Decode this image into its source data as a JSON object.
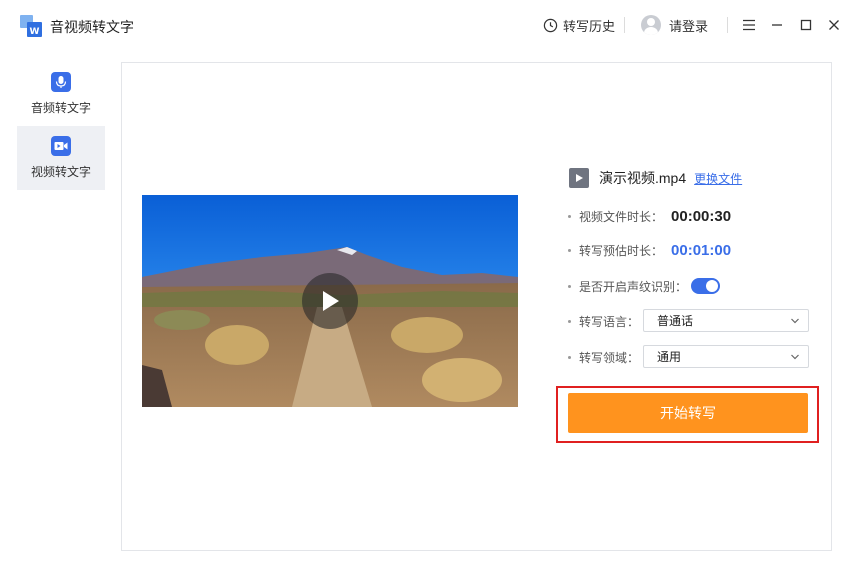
{
  "app": {
    "title": "音视频转文字"
  },
  "header": {
    "history_label": "转写历史",
    "login_label": "请登录"
  },
  "sidebar": {
    "items": [
      {
        "label": "音频转文字",
        "icon": "microphone-icon",
        "active": false
      },
      {
        "label": "视频转文字",
        "icon": "video-camera-icon",
        "active": true
      }
    ]
  },
  "file": {
    "name": "演示视频.mp4",
    "change_label": "更换文件"
  },
  "info": {
    "duration_label": "视频文件时长：",
    "duration_value": "00:00:30",
    "estimate_label": "转写预估时长：",
    "estimate_value": "00:01:00",
    "voiceprint_label": "是否开启声纹识别：",
    "voiceprint_enabled": true,
    "language_label": "转写语言：",
    "language_value": "普通话",
    "domain_label": "转写领域：",
    "domain_value": "通用"
  },
  "actions": {
    "start_label": "开始转写"
  },
  "colors": {
    "accent": "#3a6ee8",
    "start_button": "#ff931e",
    "highlight_border": "#e02020"
  }
}
